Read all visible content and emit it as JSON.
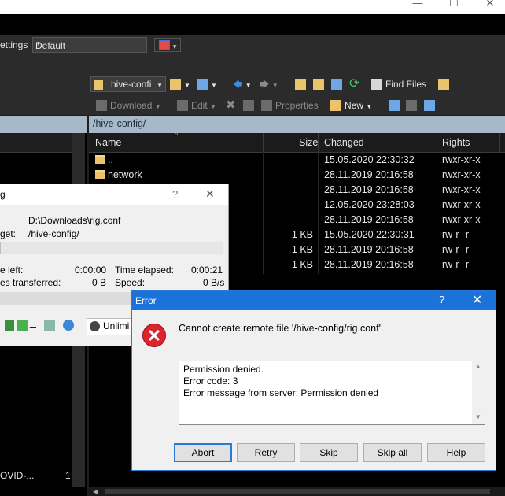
{
  "window": {
    "minimize": "—",
    "maximize": "☐",
    "close": "✕"
  },
  "toolbar": {
    "settings_label": "ettings",
    "settings_value": "Default",
    "remote_dir": "hive-confi",
    "find_files": "Find Files",
    "download": "Download",
    "edit": "Edit",
    "properties": "Properties",
    "new": "New"
  },
  "remote_panel": {
    "path": "/hive-config/",
    "columns": {
      "name": "Name",
      "size": "Size",
      "changed": "Changed",
      "rights": "Rights"
    },
    "rows": [
      {
        "name": "..",
        "size": "",
        "changed": "15.05.2020 22:30:32",
        "rights": "rwxr-xr-x"
      },
      {
        "name": "network",
        "size": "",
        "changed": "28.11.2019 20:16:58",
        "rights": "rwxr-xr-x"
      },
      {
        "name": "",
        "size": "",
        "changed": "28.11.2019 20:16:58",
        "rights": "rwxr-xr-x"
      },
      {
        "name": "",
        "size": "",
        "changed": "12.05.2020 23:28:03",
        "rights": "rwxr-xr-x"
      },
      {
        "name": "",
        "size": "",
        "changed": "28.11.2019 20:16:58",
        "rights": "rwxr-xr-x"
      },
      {
        "name": "",
        "size": "1 KB",
        "changed": "15.05.2020 22:30:31",
        "rights": "rw-r--r--"
      },
      {
        "name": "",
        "size": "1 KB",
        "changed": "28.11.2019 20:16:58",
        "rights": "rw-r--r--"
      },
      {
        "name": "",
        "size": "1 KB",
        "changed": "28.11.2019 20:16:58",
        "rights": "rw-r--r--"
      }
    ]
  },
  "local_panel": {
    "bottom_item": "OVID-...",
    "bottom_item_extra": "1"
  },
  "progress_dialog": {
    "title": "g",
    "help": "?",
    "close": "✕",
    "source": "D:\\Downloads\\rig.conf",
    "target_label": "get:",
    "target": "/hive-config/",
    "time_left_label": "e left:",
    "time_left": "0:00:00",
    "time_elapsed_label": "Time elapsed:",
    "time_elapsed": "0:00:21",
    "bytes_label": "es transferred:",
    "bytes": "0 B",
    "speed_label": "Speed:",
    "speed": "0 B/s",
    "unlimited": "Unlimi",
    "minimize": "_"
  },
  "error_dialog": {
    "title": "Error",
    "help": "?",
    "close": "✕",
    "message": "Cannot create remote file '/hive-config/rig.conf'.",
    "details": [
      "Permission denied.",
      "Error code: 3",
      "Error message from server: Permission denied"
    ],
    "buttons": {
      "abort": {
        "accel": "A",
        "rest": "bort"
      },
      "retry": {
        "accel": "R",
        "rest": "etry"
      },
      "skip": {
        "accel": "S",
        "rest": "kip"
      },
      "skip_all": {
        "pre": "Skip ",
        "accel": "a",
        "rest": "ll"
      },
      "help": {
        "accel": "H",
        "rest": "elp"
      }
    }
  },
  "colors": {
    "accent": "#1b73d9",
    "error_red": "#d9252b",
    "folder": "#e9c46a",
    "path_bar": "#a7b8c8"
  }
}
